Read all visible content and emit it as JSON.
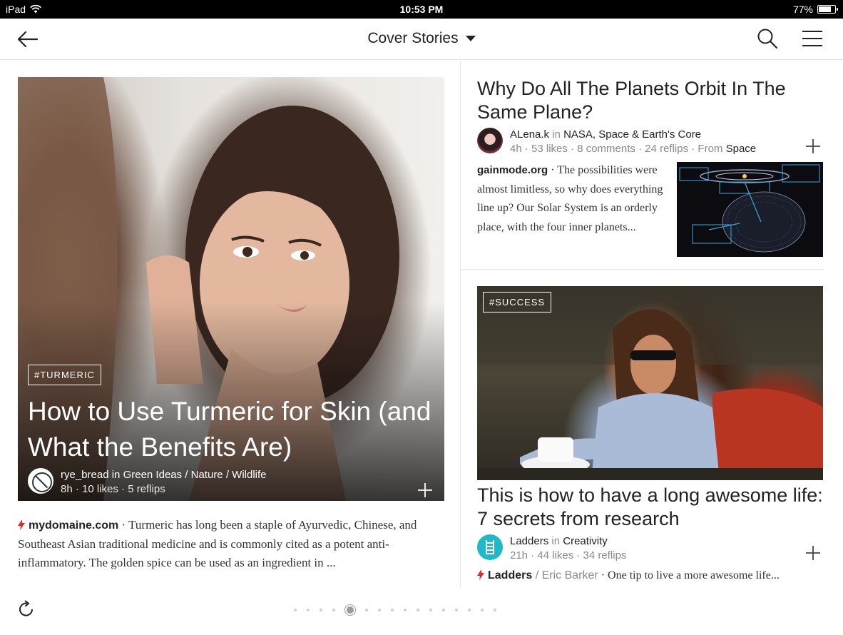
{
  "status_bar": {
    "device": "iPad",
    "time": "10:53 PM",
    "battery": "77%",
    "battery_level": 0.77
  },
  "header": {
    "title": "Cover Stories"
  },
  "stories": {
    "left": {
      "tag": "#TURMERIC",
      "title": "How to Use Turmeric for Skin (and What the Benefits Are)",
      "author": "rye_bread",
      "in": "in",
      "magazine": "Green Ideas / Nature / Wildlife",
      "stats": "8h · 10 likes · 5 reflips",
      "source": "mydomaine.com",
      "excerpt": " · Turmeric has long been a staple of Ayurvedic, Chinese, and Southeast Asian traditional medicine and is commonly cited as a potent anti-inflammatory. The golden spice can be used as an ingredient in ..."
    },
    "right_top": {
      "title": "Why Do All The Planets Orbit In The Same Plane?",
      "author": "ALena.k",
      "in": "in",
      "magazine": "NASA, Space & Earth's Core",
      "stats": "4h · 53 likes · 8 comments · 24 reflips · From ",
      "from": "Space",
      "source": "gainmode.org",
      "excerpt": " · The possibilities were almost limitless, so why does everything line up? Our Solar System is an orderly place, with the four inner planets..."
    },
    "right_bottom": {
      "tag": "#SUCCESS",
      "title": "This is how to have a long awesome life: 7 secrets from research",
      "author": "Ladders",
      "in": "in",
      "magazine": "Creativity",
      "stats": "21h · 44 likes · 34 reflips",
      "source": "Ladders",
      "source_author": " / Eric Barker",
      "excerpt": " · One tip to live a more awesome life..."
    }
  },
  "pager": {
    "total_pages": 16,
    "current_page": 5
  },
  "colors": {
    "accent": "#e12828",
    "teal_avatar": "#1fb9c9"
  },
  "icons": {
    "back": "back-arrow-icon",
    "search": "search-icon",
    "menu": "hamburger-menu-icon",
    "add": "plus-icon",
    "refresh": "refresh-icon",
    "flame": "flipboard-flame-icon"
  }
}
